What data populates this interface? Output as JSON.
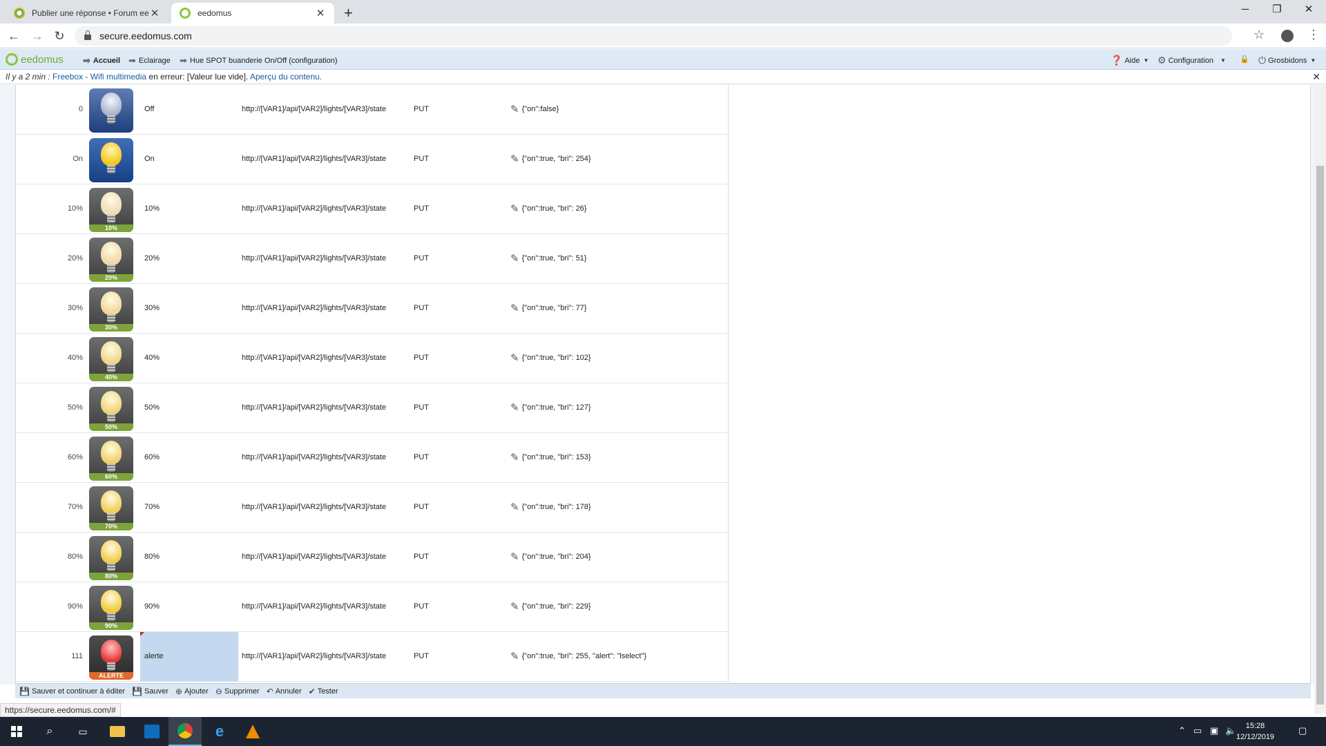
{
  "browser": {
    "tabs": [
      {
        "title": "Publier une réponse • Forum eed",
        "active": false
      },
      {
        "title": "eedomus",
        "active": true
      }
    ],
    "url": "secure.eedomus.com",
    "status_url": "https://secure.eedomus.com/#"
  },
  "app": {
    "logo": "eedomus",
    "breadcrumb": [
      "Accueil",
      "Eclairage",
      "Hue SPOT buanderie On/Off (configuration)"
    ],
    "menu": {
      "help": "Aide",
      "config": "Configuration",
      "user": "Grosbidons"
    }
  },
  "notification": {
    "time": "Il y a 2 min :",
    "source": "Freebox - Wifi multimedia",
    "middle": "en erreur: [Valeur lue vide].",
    "link": "Aperçu du contenu."
  },
  "rows": [
    {
      "value": "0",
      "desc": "Off",
      "url": "http://[VAR1]/api/[VAR2]/lights/[VAR3]/state",
      "method": "PUT",
      "body": "{\"on\":false}",
      "icon": "off",
      "badge": ""
    },
    {
      "value": "On",
      "desc": "On",
      "url": "http://[VAR1]/api/[VAR2]/lights/[VAR3]/state",
      "method": "PUT",
      "body": "{\"on\":true, \"bri\": 254}",
      "icon": "on",
      "badge": ""
    },
    {
      "value": "10%",
      "desc": "10%",
      "url": "http://[VAR1]/api/[VAR2]/lights/[VAR3]/state",
      "method": "PUT",
      "body": "{\"on\":true, \"bri\": 26}",
      "icon": "pct",
      "badge": "10%",
      "level": 0.1
    },
    {
      "value": "20%",
      "desc": "20%",
      "url": "http://[VAR1]/api/[VAR2]/lights/[VAR3]/state",
      "method": "PUT",
      "body": "{\"on\":true, \"bri\": 51}",
      "icon": "pct",
      "badge": "20%",
      "level": 0.2
    },
    {
      "value": "30%",
      "desc": "30%",
      "url": "http://[VAR1]/api/[VAR2]/lights/[VAR3]/state",
      "method": "PUT",
      "body": "{\"on\":true, \"bri\": 77}",
      "icon": "pct",
      "badge": "30%",
      "level": 0.3
    },
    {
      "value": "40%",
      "desc": "40%",
      "url": "http://[VAR1]/api/[VAR2]/lights/[VAR3]/state",
      "method": "PUT",
      "body": "{\"on\":true, \"bri\": 102}",
      "icon": "pct",
      "badge": "40%",
      "level": 0.4
    },
    {
      "value": "50%",
      "desc": "50%",
      "url": "http://[VAR1]/api/[VAR2]/lights/[VAR3]/state",
      "method": "PUT",
      "body": "{\"on\":true, \"bri\": 127}",
      "icon": "pct",
      "badge": "50%",
      "level": 0.5
    },
    {
      "value": "60%",
      "desc": "60%",
      "url": "http://[VAR1]/api/[VAR2]/lights/[VAR3]/state",
      "method": "PUT",
      "body": "{\"on\":true, \"bri\": 153}",
      "icon": "pct",
      "badge": "60%",
      "level": 0.6
    },
    {
      "value": "70%",
      "desc": "70%",
      "url": "http://[VAR1]/api/[VAR2]/lights/[VAR3]/state",
      "method": "PUT",
      "body": "{\"on\":true, \"bri\": 178}",
      "icon": "pct",
      "badge": "70%",
      "level": 0.7
    },
    {
      "value": "80%",
      "desc": "80%",
      "url": "http://[VAR1]/api/[VAR2]/lights/[VAR3]/state",
      "method": "PUT",
      "body": "{\"on\":true, \"bri\": 204}",
      "icon": "pct",
      "badge": "80%",
      "level": 0.8
    },
    {
      "value": "90%",
      "desc": "90%",
      "url": "http://[VAR1]/api/[VAR2]/lights/[VAR3]/state",
      "method": "PUT",
      "body": "{\"on\":true, \"bri\": 229}",
      "icon": "pct",
      "badge": "90%",
      "level": 0.9
    },
    {
      "value": "111",
      "desc": "alerte",
      "url": "http://[VAR1]/api/[VAR2]/lights/[VAR3]/state",
      "method": "PUT",
      "body": "{\"on\":true, \"bri\": 255, \"alert\": \"lselect\"}",
      "icon": "alert",
      "badge": "ALERTE",
      "selected": true
    }
  ],
  "toolbar": {
    "save_continue": "Sauver et continuer à éditer",
    "save": "Sauver",
    "add": "Ajouter",
    "delete": "Supprimer",
    "cancel": "Annuler",
    "test": "Tester"
  },
  "taskbar": {
    "time": "15:28",
    "date": "12/12/2019"
  },
  "colors": {
    "accent": "#8cc63f",
    "appbar": "#dde9f5",
    "selection": "#c4d8ef",
    "badge": "#7da43a",
    "alert_badge": "#e06a2b"
  }
}
